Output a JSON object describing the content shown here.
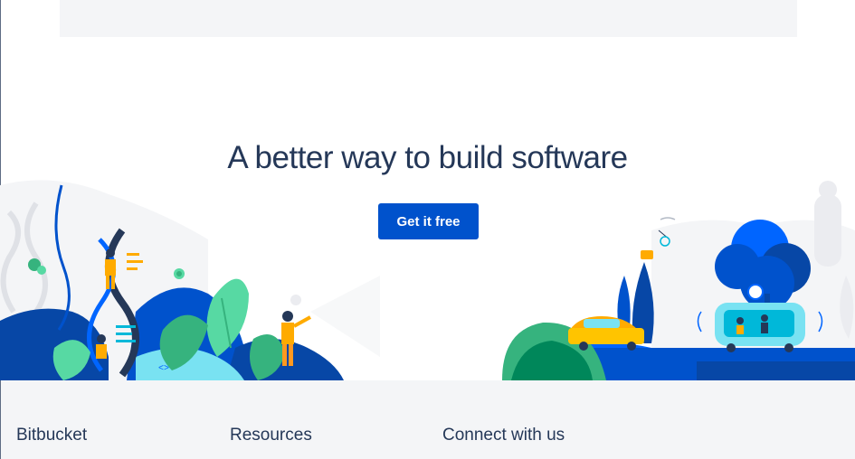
{
  "hero": {
    "title": "A better way to build software",
    "cta_label": "Get it free"
  },
  "footer": {
    "columns": [
      "Bitbucket",
      "Resources",
      "Connect with us"
    ]
  },
  "colors": {
    "primary": "#0052cc",
    "text": "#253858",
    "footer_bg": "#f4f5f7"
  }
}
